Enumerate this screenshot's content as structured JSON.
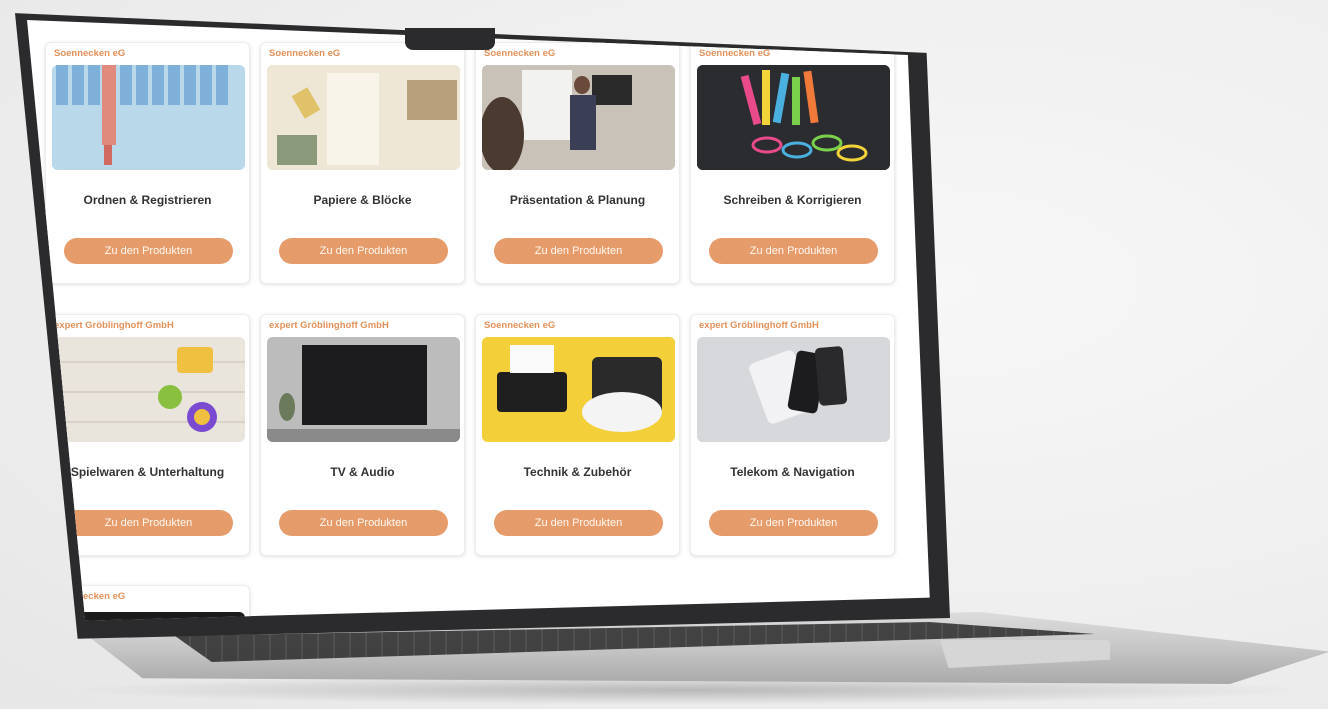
{
  "cards": [
    {
      "seller": "Soennecken eG",
      "title": "Ordnen & Registrieren",
      "button": "Zu den Produkten",
      "image": "binders"
    },
    {
      "seller": "Soennecken eG",
      "title": "Papiere & Blöcke",
      "button": "Zu den Produkten",
      "image": "paper"
    },
    {
      "seller": "Soennecken eG",
      "title": "Präsentation & Planung",
      "button": "Zu den Produkten",
      "image": "presentation"
    },
    {
      "seller": "Soennecken eG",
      "title": "Schreiben & Korrigieren",
      "button": "Zu den Produkten",
      "image": "pens"
    },
    {
      "seller": "expert Gröblinghoff GmbH",
      "title": "Spielwaren & Unterhaltung",
      "button": "Zu den Produkten",
      "image": "toys"
    },
    {
      "seller": "expert Gröblinghoff GmbH",
      "title": "TV & Audio",
      "button": "Zu den Produkten",
      "image": "tv"
    },
    {
      "seller": "Soennecken eG",
      "title": "Technik & Zubehör",
      "button": "Zu den Produkten",
      "image": "shredder"
    },
    {
      "seller": "expert Gröblinghoff GmbH",
      "title": "Telekom & Navigation",
      "button": "Zu den Produkten",
      "image": "phones"
    },
    {
      "seller": "Soennecken eG",
      "image": "markers"
    }
  ],
  "colors": {
    "accent": "#e69b6a",
    "seller_text": "#e4915a",
    "laptop_bezel": "#2b2b2d"
  }
}
